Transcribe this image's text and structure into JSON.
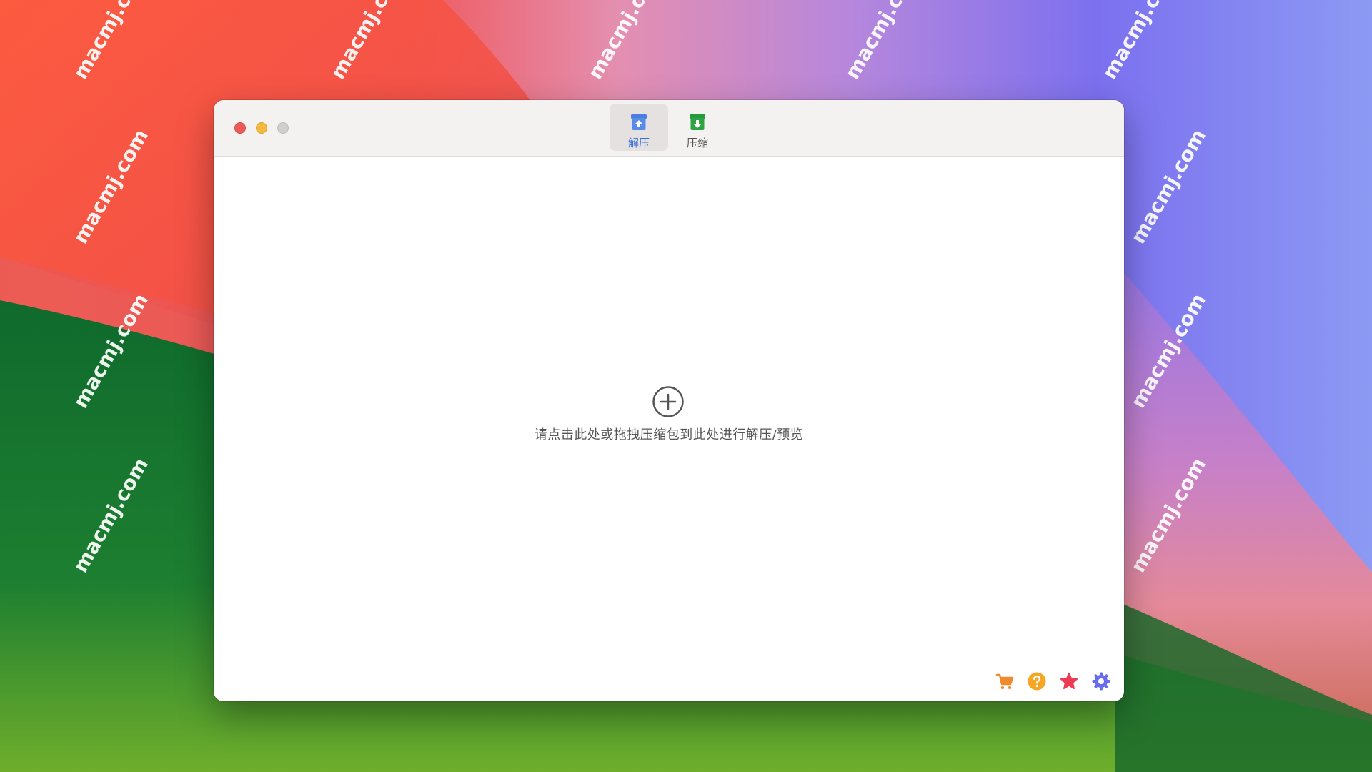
{
  "watermark": {
    "text": "macmj.com"
  },
  "window": {
    "tabs": [
      {
        "label": "解压",
        "icon": "archive-upload-icon",
        "color": "#4a7de0",
        "active": true
      },
      {
        "label": "压缩",
        "icon": "archive-download-icon",
        "color": "#2ea343",
        "active": false
      }
    ],
    "drop_zone": {
      "icon": "plus-circle-icon",
      "hint": "请点击此处或拖拽压缩包到此处进行解压/预览"
    },
    "bottom_icons": [
      {
        "icon": "cart-icon",
        "color": "#f08a2e"
      },
      {
        "icon": "help-icon",
        "color": "#f5a623"
      },
      {
        "icon": "star-icon",
        "color": "#ec3b53"
      },
      {
        "icon": "settings-icon",
        "color": "#6a6cf0"
      }
    ]
  },
  "colors": {
    "traffic_close": "#ee5d55",
    "traffic_minimize": "#f5b93b",
    "traffic_zoom": "#d1cfcd"
  }
}
